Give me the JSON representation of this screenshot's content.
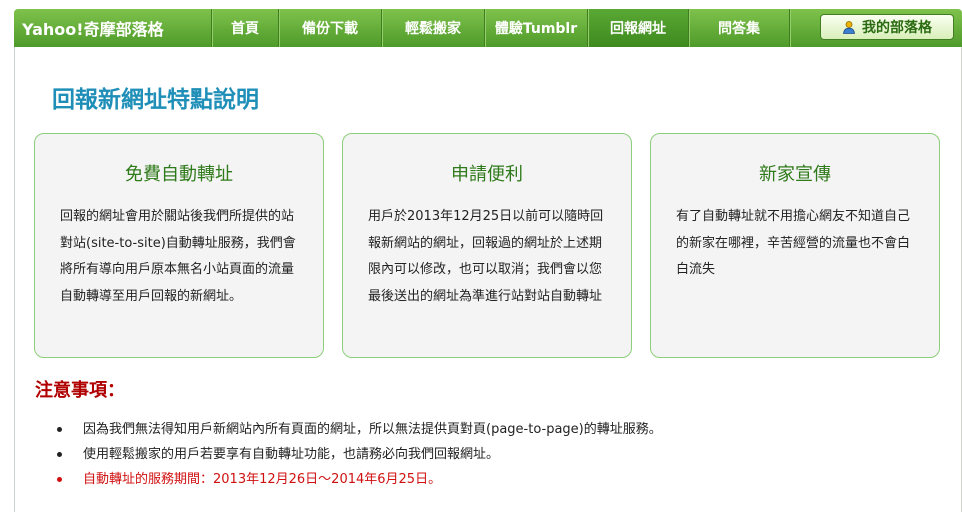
{
  "nav": {
    "brand": "Yahoo!奇摩部落格",
    "tabs": [
      {
        "label": "首頁",
        "active": false
      },
      {
        "label": "備份下載",
        "active": false
      },
      {
        "label": "輕鬆搬家",
        "active": false
      },
      {
        "label": "體驗Tumblr",
        "active": false
      },
      {
        "label": "回報網址",
        "active": true
      },
      {
        "label": "問答集",
        "active": false
      }
    ],
    "my_blog_label": "我的部落格"
  },
  "main": {
    "title": "回報新網址特點說明",
    "cards": [
      {
        "title": "免費自動轉址",
        "body": "回報的網址會用於關站後我們所提供的站對站(site-to-site)自動轉址服務，我們會將所有導向用戶原本無名小站頁面的流量自動轉導至用戶回報的新網址。"
      },
      {
        "title": "申請便利",
        "body": "用戶於2013年12月25日以前可以隨時回報新網站的網址，回報過的網址於上述期限內可以修改，也可以取消；我們會以您最後送出的網址為準進行站對站自動轉址"
      },
      {
        "title": "新家宣傳",
        "body": "有了自動轉址就不用擔心網友不知道自己的新家在哪裡，辛苦經營的流量也不會白白流失"
      }
    ],
    "notice": {
      "title": "注意事項：",
      "items": [
        "因為我們無法得知用戶新網站內所有頁面的網址，所以無法提供頁對頁(page-to-page)的轉址服務。",
        "使用輕鬆搬家的用戶若要享有自動轉址功能，也請務必向我們回報網址。",
        "自動轉址的服務期間：2013年12月26日～2014年6月25日。"
      ]
    }
  },
  "colors": {
    "nav_green": "#5aa834",
    "title_blue": "#1f8fb8",
    "card_title_green": "#2f7a1a",
    "card_border": "#8ccf7a",
    "warning_red": "#d01010"
  },
  "icons": {
    "my_blog": "user-icon"
  }
}
